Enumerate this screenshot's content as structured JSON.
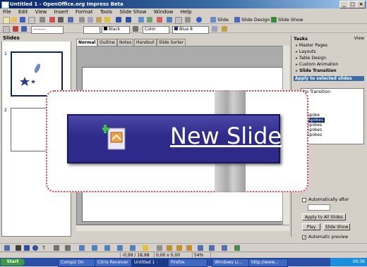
{
  "window": {
    "title": "Untitled 1 - OpenOffice.org Impress Beta"
  },
  "menubar": [
    "File",
    "Edit",
    "View",
    "Insert",
    "Format",
    "Tools",
    "Slide Show",
    "Window",
    "Help"
  ],
  "toolbar1": {
    "slide_label": "Slide",
    "slide_design_label": "Slide Design",
    "slide_show_label": "Slide Show"
  },
  "toolbar2": {
    "line_color": "Black",
    "area_style": "Color",
    "area_color": "Blue 8"
  },
  "slides_pane": {
    "title": "Slides",
    "thumbs": [
      "1",
      "2"
    ]
  },
  "view_tabs": [
    "Normal",
    "Outline",
    "Notes",
    "Handout",
    "Slide Sorter"
  ],
  "tasks": {
    "title": "Tasks",
    "view_label": "View",
    "links": [
      "Master Pages",
      "Layouts",
      "Table Design",
      "Custom Animation",
      "Slide Transition"
    ],
    "apply_label": "Apply to selected slides",
    "transitions": [
      "No Transition",
      "1 Spoke",
      "2 Spokes",
      "3 Spokes",
      "4 Spokes",
      "8 Spokes"
    ],
    "selected_transition": "2 Spokes",
    "auto_after_label": "Automatically after",
    "apply_all_button": "Apply to All Slides",
    "play_button": "Play",
    "slideshow_button": "Slide Show",
    "auto_preview_label": "Automatic preview"
  },
  "status": {
    "position": "-0,99 / 18,98",
    "size": "0,00 x 0,00",
    "zoom": "54%"
  },
  "taskbar": {
    "start_label": "Start",
    "items": [
      "Compiz On",
      "Citrix Receiver",
      "Untitled 1 -",
      "Firefox",
      "Windows Li...",
      "http://www..."
    ],
    "clock": "09:36"
  },
  "callout": {
    "label": "New Slide",
    "accent": "#2e2a8a",
    "border": "#e8373a"
  },
  "colors": {
    "titlebar": "#0a246a",
    "selection": "#0a246a"
  }
}
